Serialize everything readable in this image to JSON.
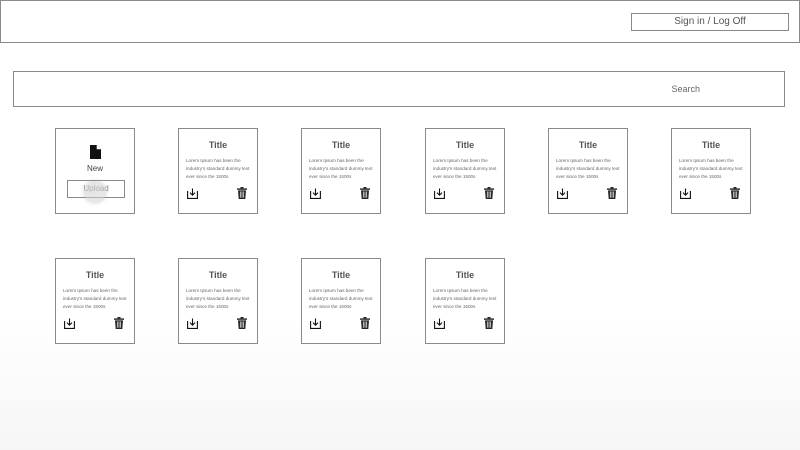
{
  "header": {
    "signin_label": "Sign in / Log Off"
  },
  "search": {
    "placeholder": "Search"
  },
  "new_card": {
    "icon": "file-icon",
    "label": "New",
    "upload_label": "Upload"
  },
  "cards": [
    {
      "title": "Title",
      "text": "Lorem Ipsum has been the industry's standard dummy text ever since the 1500s"
    },
    {
      "title": "Title",
      "text": "Lorem Ipsum has been the industry's standard dummy text ever since the 1500s"
    },
    {
      "title": "Title",
      "text": "Lorem Ipsum has been the industry's standard dummy text ever since the 1500s"
    },
    {
      "title": "Title",
      "text": "Lorem Ipsum has been the industry's standard dummy text ever since the 1500s"
    },
    {
      "title": "Title",
      "text": "Lorem Ipsum has been the industry's standard dummy text ever since the 1500s"
    },
    {
      "title": "Title",
      "text": "Lorem Ipsum has been the industry's standard dummy text ever since the 1500s"
    },
    {
      "title": "Title",
      "text": "Lorem Ipsum has been the industry's standard dummy text ever since the 1500s"
    },
    {
      "title": "Title",
      "text": "Lorem Ipsum has been the industry's standard dummy text ever since the 1500s"
    },
    {
      "title": "Title",
      "text": "Lorem Ipsum has been the industry's standard dummy text ever since the 1500s"
    }
  ],
  "icons": {
    "download": "download-icon",
    "delete": "trash-icon"
  }
}
